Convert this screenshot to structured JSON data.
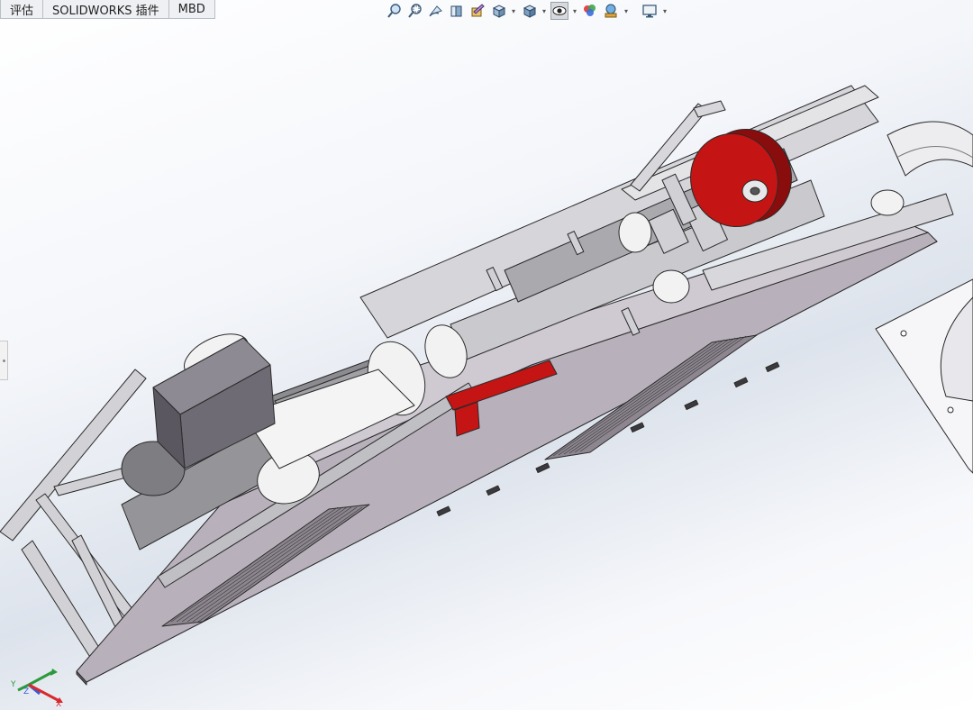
{
  "tabs": [
    {
      "label": "评估"
    },
    {
      "label": "SOLIDWORKS 插件"
    },
    {
      "label": "MBD"
    }
  ],
  "heads_up_toolbar": {
    "icons": [
      "zoom-to-fit-icon",
      "zoom-to-area-icon",
      "previous-view-icon",
      "section-view-icon",
      "dynamic-annotation-icon",
      "view-orientation-icon",
      "display-style-icon",
      "hide-show-items-icon",
      "edit-appearance-icon",
      "apply-scene-icon",
      "view-settings-icon"
    ],
    "dropdown_caret": "▾"
  },
  "triad": {
    "x_label": "X",
    "y_label": "Y",
    "z_label": "Z"
  },
  "colors": {
    "accent_red": "#c41414",
    "plate": "#b9b2bd",
    "plate_light": "#d9d4dc",
    "frame": "#cfcfd4",
    "belt": "#8b8b90",
    "roller": "#f2f2f2",
    "edge": "#2a2a2a"
  }
}
